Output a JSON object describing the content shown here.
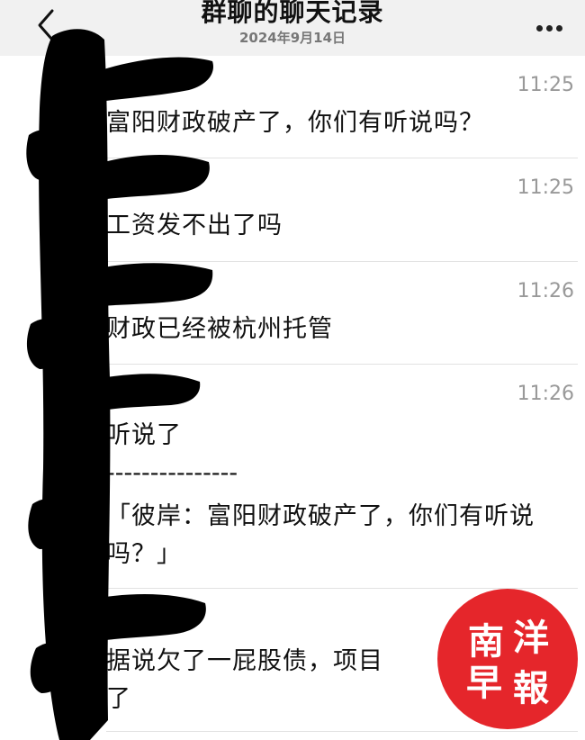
{
  "header": {
    "title": "群聊的聊天记录",
    "subtitle": "2024年9月14日",
    "back_icon": "chevron-left-icon",
    "more_icon": "more-horizontal-icon"
  },
  "messages": [
    {
      "time": "11:25",
      "text": "富阳财政破产了，你们有听说吗？"
    },
    {
      "time": "11:25",
      "text": "工资发不出了吗"
    },
    {
      "time": "11:26",
      "text": "财政已经被杭州托管"
    },
    {
      "time": "11:26",
      "text": "听说了",
      "quote_separator": "---------------",
      "quote": "「彼岸：富阳财政破产了，你们有听说吗？」"
    },
    {
      "time": "",
      "text": "据说欠了一屁股债，项目",
      "text_line2": "了"
    }
  ],
  "watermark": {
    "text": "南洋早報",
    "color": "#e5262b"
  },
  "colors": {
    "header_bg": "#f1f1f1",
    "time": "#999999",
    "redaction": "#000000"
  }
}
